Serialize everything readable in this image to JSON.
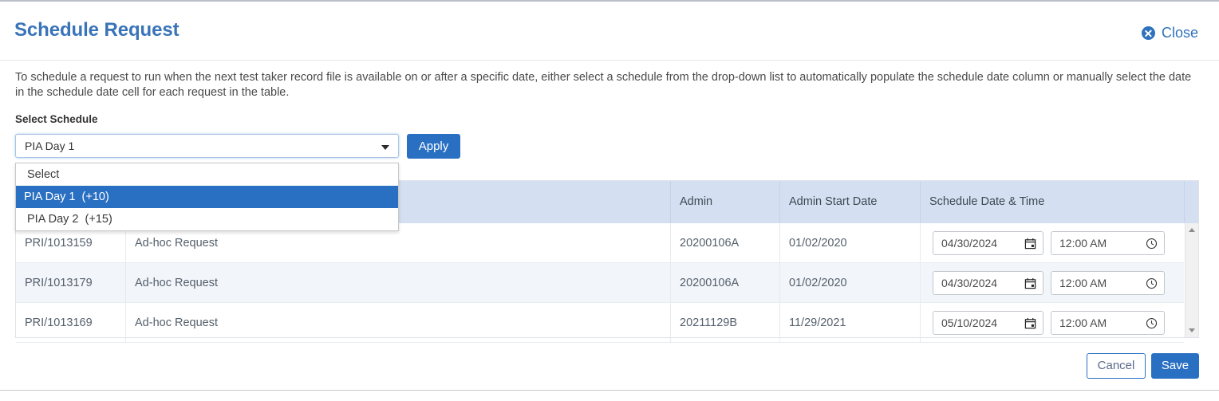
{
  "header": {
    "title": "Schedule Request",
    "close_label": "Close",
    "close_icon": "close-circle-icon"
  },
  "description": "To schedule a request to run when the next test taker record file is available on or after a specific date, either select a schedule from the drop-down list to automatically populate the schedule date column or manually select the date in the schedule date cell for each request in the table.",
  "schedule_select": {
    "label": "Select Schedule",
    "value": "PIA Day 1",
    "caret_icon": "chevron-down-icon",
    "apply_label": "Apply",
    "options": [
      {
        "label": "Select",
        "selected": false
      },
      {
        "label": "PIA Day 1  (+10)",
        "selected": true
      },
      {
        "label": "PIA Day 2  (+15)",
        "selected": false
      }
    ]
  },
  "table": {
    "columns": [
      "",
      "",
      "",
      "Admin",
      "Admin Start Date",
      "Schedule Date & Time"
    ],
    "rows": [
      {
        "request_id": "PRI/1013159",
        "request_type": "Ad-hoc Request",
        "blank": "",
        "admin": "20200106A",
        "admin_start_date": "01/02/2020",
        "schedule_date": "04/30/2024",
        "schedule_time": "12:00 AM"
      },
      {
        "request_id": "PRI/1013179",
        "request_type": "Ad-hoc Request",
        "blank": "",
        "admin": "20200106A",
        "admin_start_date": "01/02/2020",
        "schedule_date": "04/30/2024",
        "schedule_time": "12:00 AM"
      },
      {
        "request_id": "PRI/1013169",
        "request_type": "Ad-hoc Request",
        "blank": "",
        "admin": "20211129B",
        "admin_start_date": "11/29/2021",
        "schedule_date": "05/10/2024",
        "schedule_time": "12:00 AM"
      }
    ],
    "date_icon": "calendar-icon",
    "time_icon": "clock-icon",
    "scroll_up_icon": "scroll-up-arrow-icon",
    "scroll_down_icon": "scroll-down-arrow-icon"
  },
  "footer": {
    "cancel_label": "Cancel",
    "save_label": "Save"
  },
  "colors": {
    "accent_blue": "#2a70c2",
    "title_blue": "#3a74b8",
    "header_row": "#d4e0f1",
    "alt_row": "#f2f5fa"
  }
}
